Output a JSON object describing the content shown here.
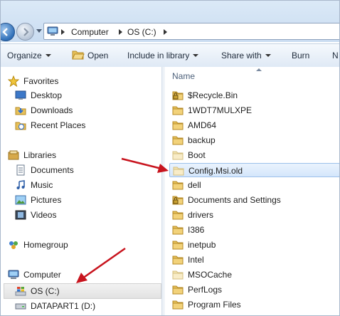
{
  "address": {
    "crumbs": [
      "Computer",
      "OS (C:)"
    ]
  },
  "toolbar": {
    "organize": "Organize",
    "open": "Open",
    "include_in_library": "Include in library",
    "share_with": "Share with",
    "burn": "Burn",
    "overflow": "N"
  },
  "nav": {
    "favorites": "Favorites",
    "desktop": "Desktop",
    "downloads": "Downloads",
    "recent_places": "Recent Places",
    "libraries": "Libraries",
    "documents": "Documents",
    "music": "Music",
    "pictures": "Pictures",
    "videos": "Videos",
    "homegroup": "Homegroup",
    "computer": "Computer",
    "os_c": "OS (C:)",
    "datapart1": "DATAPART1 (D:)"
  },
  "files": {
    "column_name": "Name",
    "items": [
      "$Recycle.Bin",
      "1WDT7MULXPE",
      "AMD64",
      "backup",
      "Boot",
      "Config.Msi.old",
      "dell",
      "Documents and Settings",
      "drivers",
      "I386",
      "inetpub",
      "Intel",
      "MSOCache",
      "PerfLogs",
      "Program Files"
    ],
    "selected_item": "Config.Msi.old"
  },
  "colors": {
    "folder": "#e7c15a",
    "annotation_arrow": "#c8141e",
    "selection": "#d4e6fb"
  }
}
